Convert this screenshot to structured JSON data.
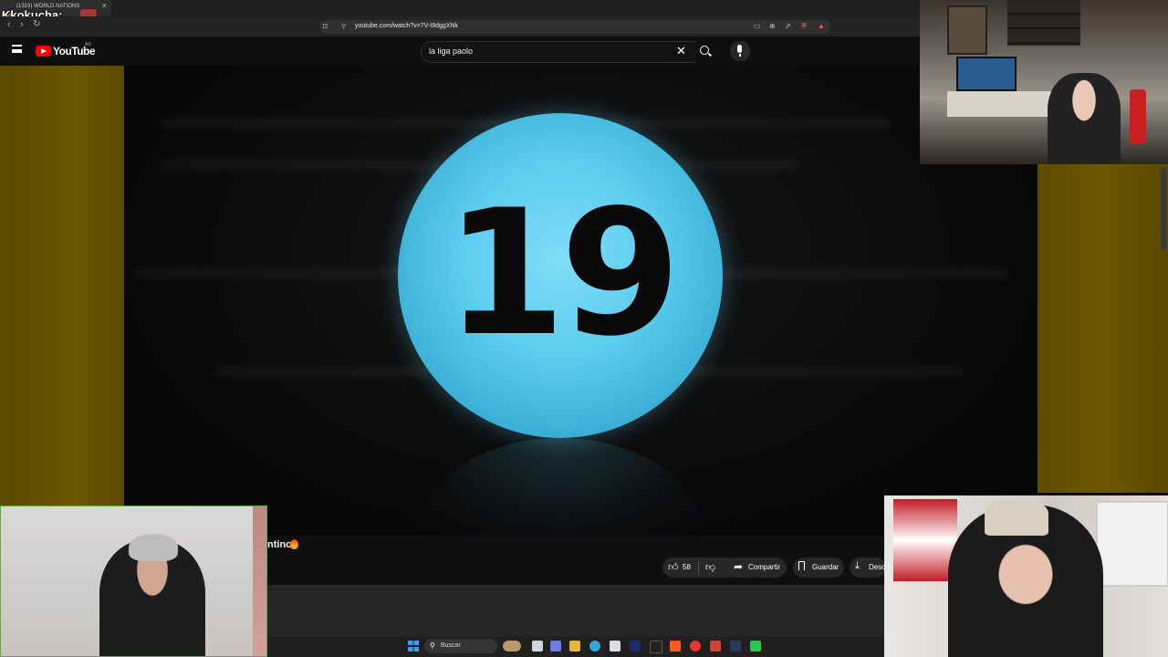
{
  "browser": {
    "tab_title": "(1323) WORLD NATIONS",
    "url": "youtube.com/watch?v=7V-I8dggXNk",
    "chat_overlay_name": "Kkokucha:"
  },
  "youtube": {
    "logo_text": "YouTube",
    "country_code": "AR",
    "search_query": "la liga paolo"
  },
  "video": {
    "ball_number": "19",
    "ball_color": "#5ccdee",
    "title_fragment": "ntino"
  },
  "actions": {
    "like_count": "58",
    "share_label": "Compartir",
    "save_label": "Guardar",
    "download_label": "Desc"
  },
  "taskbar": {
    "search_label": "Buscar"
  },
  "icons": [
    "menu-icon",
    "youtube-logo-icon",
    "search-icon",
    "mic-icon",
    "clear-icon",
    "like-icon",
    "dislike-icon",
    "share-icon",
    "save-icon",
    "download-icon",
    "fire-icon",
    "bookmark-icon",
    "windows-start-icon"
  ]
}
